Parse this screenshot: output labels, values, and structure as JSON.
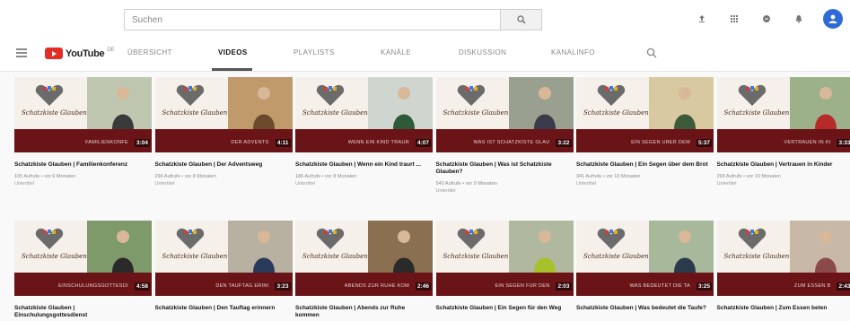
{
  "search": {
    "placeholder": "Suchen"
  },
  "topbar_icons": [
    "upload-icon",
    "apps-icon",
    "messages-icon",
    "notifications-icon"
  ],
  "channel": {
    "logo_text": "YouTube",
    "logo_sup": "DE",
    "tabs": [
      "ÜBERSICHT",
      "VIDEOS",
      "PLAYLISTS",
      "KANÄLE",
      "DISKUSSION",
      "KANALINFO"
    ],
    "active_tab": "VIDEOS"
  },
  "thumb_script": "Schatzkiste Glauben",
  "videos": [
    {
      "band": "FAMILIENKONFE",
      "duration": "3:04",
      "title": "Schatzkiste Glauben | Familienkonferenz",
      "meta": "105 Aufrufe • vor 6 Monaten",
      "badge": "Untertitel"
    },
    {
      "band": "DER ADVENTS",
      "duration": "4:11",
      "title": "Schatzkiste Glauben | Der Adventsweg",
      "meta": "296 Aufrufe • vor 8 Monaten",
      "badge": "Untertitel"
    },
    {
      "band": "WENN EIN KIND TRAUR",
      "duration": "4:07",
      "title": "Schatzkiste Glauben | Wenn ein Kind traurt ...",
      "meta": "186 Aufrufe • vor 8 Monaten",
      "badge": "Untertitel"
    },
    {
      "band": "WAS IST SCHATZKISTE GLAU",
      "duration": "3:22",
      "title": "Schatzkiste Glauben | Was ist Schatzkiste Glauben?",
      "meta": "540 Aufrufe • vor 9 Monaten",
      "badge": "Untertitel"
    },
    {
      "band": "EIN SEGEN ÜBER DEM",
      "duration": "5:37",
      "title": "Schatzkiste Glauben | Ein Segen über dem Brot",
      "meta": "341 Aufrufe • vor 10 Monaten",
      "badge": "Untertitel"
    },
    {
      "band": "VERTRAUEN IN KI",
      "duration": "3:33",
      "title": "Schatzkiste Glauben | Vertrauen in Kinder",
      "meta": "299 Aufrufe • vor 10 Monaten",
      "badge": "Untertitel"
    },
    {
      "band": "EINSCHULUNGSGOTTESDI",
      "duration": "4:58",
      "title": "Schatzkiste Glauben | Einschulungsgottesdienst",
      "meta": "",
      "badge": ""
    },
    {
      "band": "DEN TAUFTAG ERINI",
      "duration": "3:23",
      "title": "Schatzkiste Glauben | Den Tauftag erinnern",
      "meta": "",
      "badge": ""
    },
    {
      "band": "ABENDS ZUR RUHE KOM",
      "duration": "2:46",
      "title": "Schatzkiste Glauben | Abends zur Ruhe kommen",
      "meta": "",
      "badge": ""
    },
    {
      "band": "EIN SEGEN FÜR DEN",
      "duration": "2:03",
      "title": "Schatzkiste Glauben | Ein Segen für den Weg",
      "meta": "",
      "badge": ""
    },
    {
      "band": "WAS BEDEUTET DIE TA",
      "duration": "3:25",
      "title": "Schatzkiste Glauben | Was bedeutet die Taufe?",
      "meta": "",
      "badge": ""
    },
    {
      "band": "ZUM ESSEN B",
      "duration": "2:43",
      "title": "Schatzkiste Glauben | Zum Essen beten",
      "meta": "",
      "badge": ""
    }
  ],
  "colors": {
    "band": "#6a1417",
    "accent": "#e52d27",
    "avatar": "#2f6bd7"
  }
}
